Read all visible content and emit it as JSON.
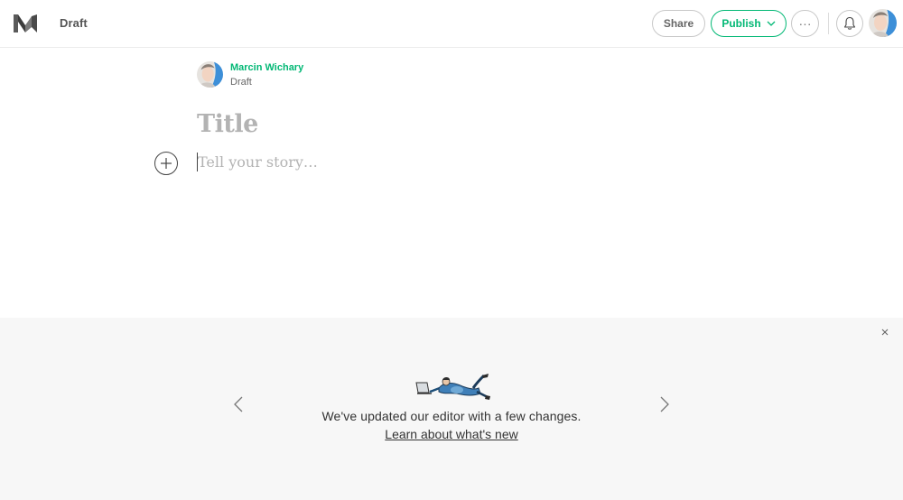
{
  "header": {
    "status_label": "Draft",
    "share_label": "Share",
    "publish_label": "Publish",
    "more_label": "···"
  },
  "author": {
    "name": "Marcin Wichary",
    "status": "Draft"
  },
  "editor": {
    "title_placeholder": "Title",
    "story_placeholder": "Tell your story…"
  },
  "banner": {
    "message": "We've updated our editor with a few changes.",
    "link_label": "Learn about what's new"
  },
  "icons": {
    "logo": "medium-logo-icon",
    "bell": "bell-icon",
    "chevron": "chevron-down-icon",
    "plus": "plus-icon",
    "close": "close-icon",
    "prev": "chevron-left-icon",
    "next": "chevron-right-icon"
  },
  "colors": {
    "accent": "#02b875",
    "placeholder": "#b3b3b3",
    "banner_bg": "#f7f7f7"
  }
}
